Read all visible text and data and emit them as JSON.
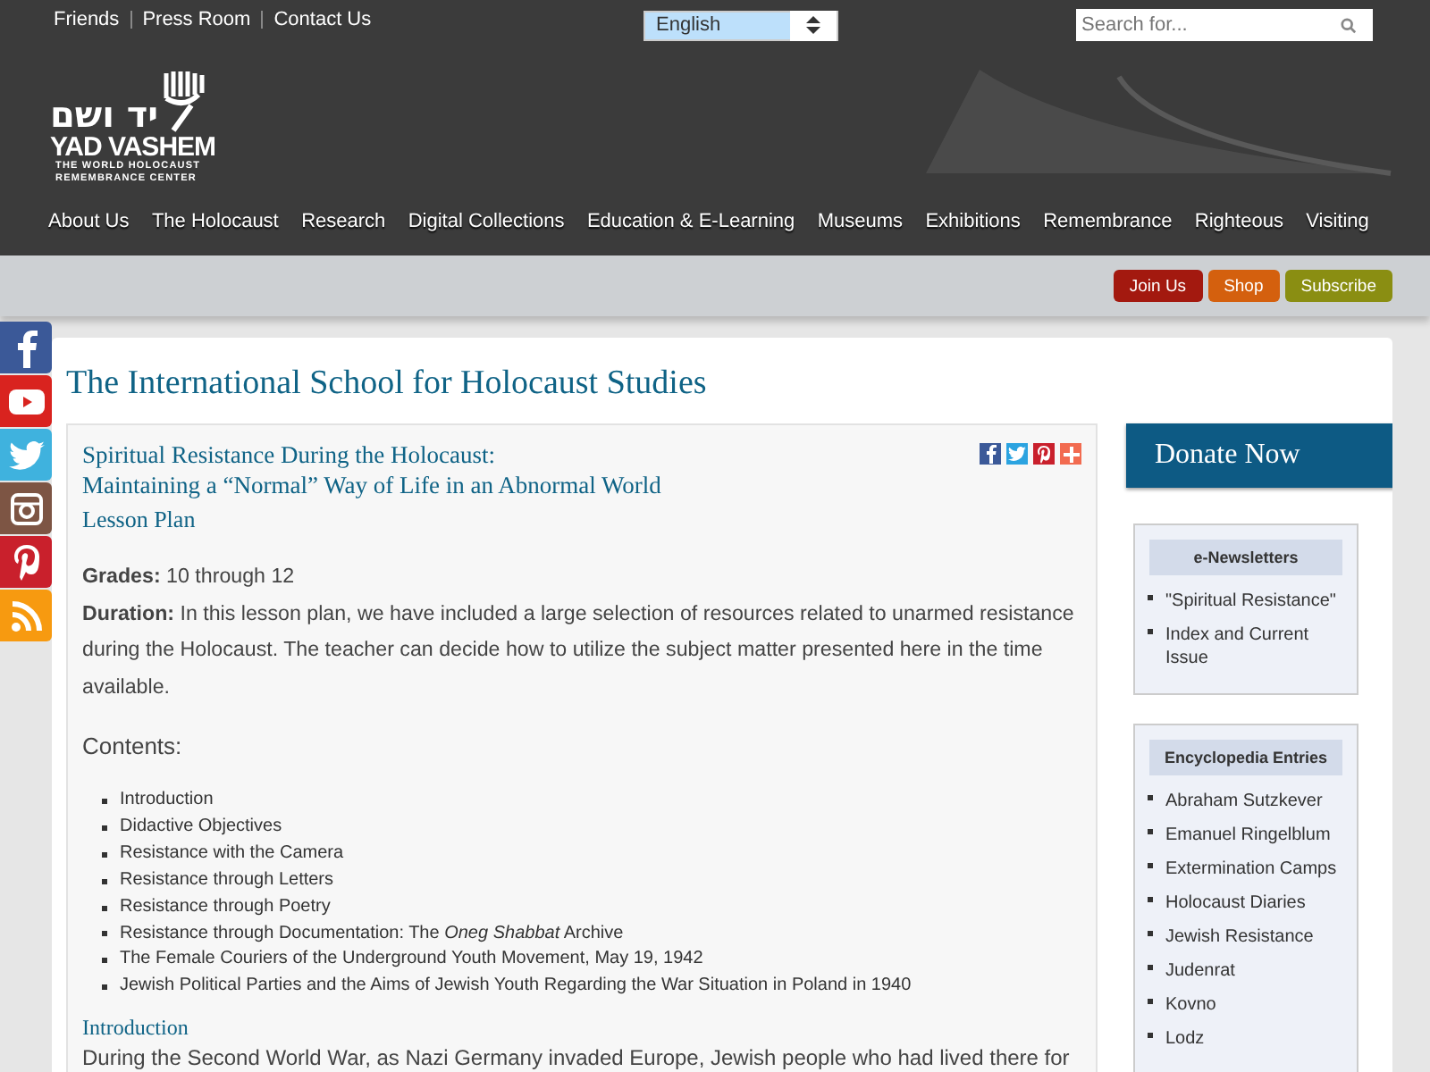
{
  "top_links": [
    "Friends",
    "Press Room",
    "Contact Us"
  ],
  "language_select": {
    "value": "English"
  },
  "search": {
    "placeholder": "Search for..."
  },
  "logo": {
    "hebrew": "יד ושם",
    "name": "YAD VASHEM",
    "tagline_1": "THE WORLD HOLOCAUST",
    "tagline_2": "REMEMBRANCE CENTER"
  },
  "nav": [
    "About Us",
    "The Holocaust",
    "Research",
    "Digital Collections",
    "Education & E-Learning",
    "Museums",
    "Exhibitions",
    "Remembrance",
    "Righteous",
    "Visiting"
  ],
  "action_buttons": [
    {
      "label": "Join Us",
      "color": "#a3190f"
    },
    {
      "label": "Shop",
      "color": "#d4600e"
    },
    {
      "label": "Subscribe",
      "color": "#8a8e12"
    }
  ],
  "social_sidebar": [
    {
      "kind": "facebook",
      "color": "#3b5998"
    },
    {
      "kind": "youtube",
      "color": "#d9231f"
    },
    {
      "kind": "twitter",
      "color": "#3fb2de"
    },
    {
      "kind": "instagram",
      "color": "#7d5544"
    },
    {
      "kind": "pinterest",
      "color": "#c9202c"
    },
    {
      "kind": "rss",
      "color": "#f79a10"
    }
  ],
  "page_title": "The International School for Holocaust Studies",
  "article": {
    "title_1": "Spiritual Resistance During the Holocaust:",
    "title_2": "Maintaining a “Normal” Way of Life in an Abnormal World",
    "subtitle": "Lesson Plan",
    "share": [
      {
        "kind": "facebook",
        "color": "#3b5998"
      },
      {
        "kind": "twitter",
        "color": "#2ba3e0"
      },
      {
        "kind": "pinterest",
        "color": "#c9202c"
      },
      {
        "kind": "plus",
        "color": "#f26b50"
      }
    ],
    "grades": "**Grades:** 10 through 12",
    "duration": "**Duration:** In this lesson plan, we have included a large selection of resources related to unarmed resistance during the Holocaust. The teacher can decide how to utilize the subject matter presented here in the time available.",
    "contents_label": "Contents:",
    "contents": [
      "Introduction",
      "Didactive Objectives",
      "Resistance with the Camera",
      "Resistance through Letters",
      "Resistance through Poetry",
      "Resistance through Documentation: The *Oneg Shabbat* Archive",
      "The Female Couriers of the Underground Youth Movement, May 19, 1942",
      "Jewish Political Parties and the Aims of Jewish Youth Regarding the War Situation in Poland in 1940"
    ],
    "section_heading": "Introduction",
    "section_text": "During the Second World War, as Nazi Germany invaded Europe, Jewish people who had lived there for"
  },
  "donate_button": "Donate Now",
  "newsletters": {
    "heading": "e-Newsletters",
    "items": [
      "\"Spiritual Resistance\"",
      "Index and Current Issue"
    ]
  },
  "encyclopedia": {
    "heading": "Encyclopedia Entries",
    "items": [
      "Abraham Sutzkever",
      "Emanuel Ringelblum",
      "Extermination Camps",
      "Holocaust Diaries",
      "Jewish Resistance",
      "Judenrat",
      "Kovno",
      "Lodz"
    ]
  }
}
